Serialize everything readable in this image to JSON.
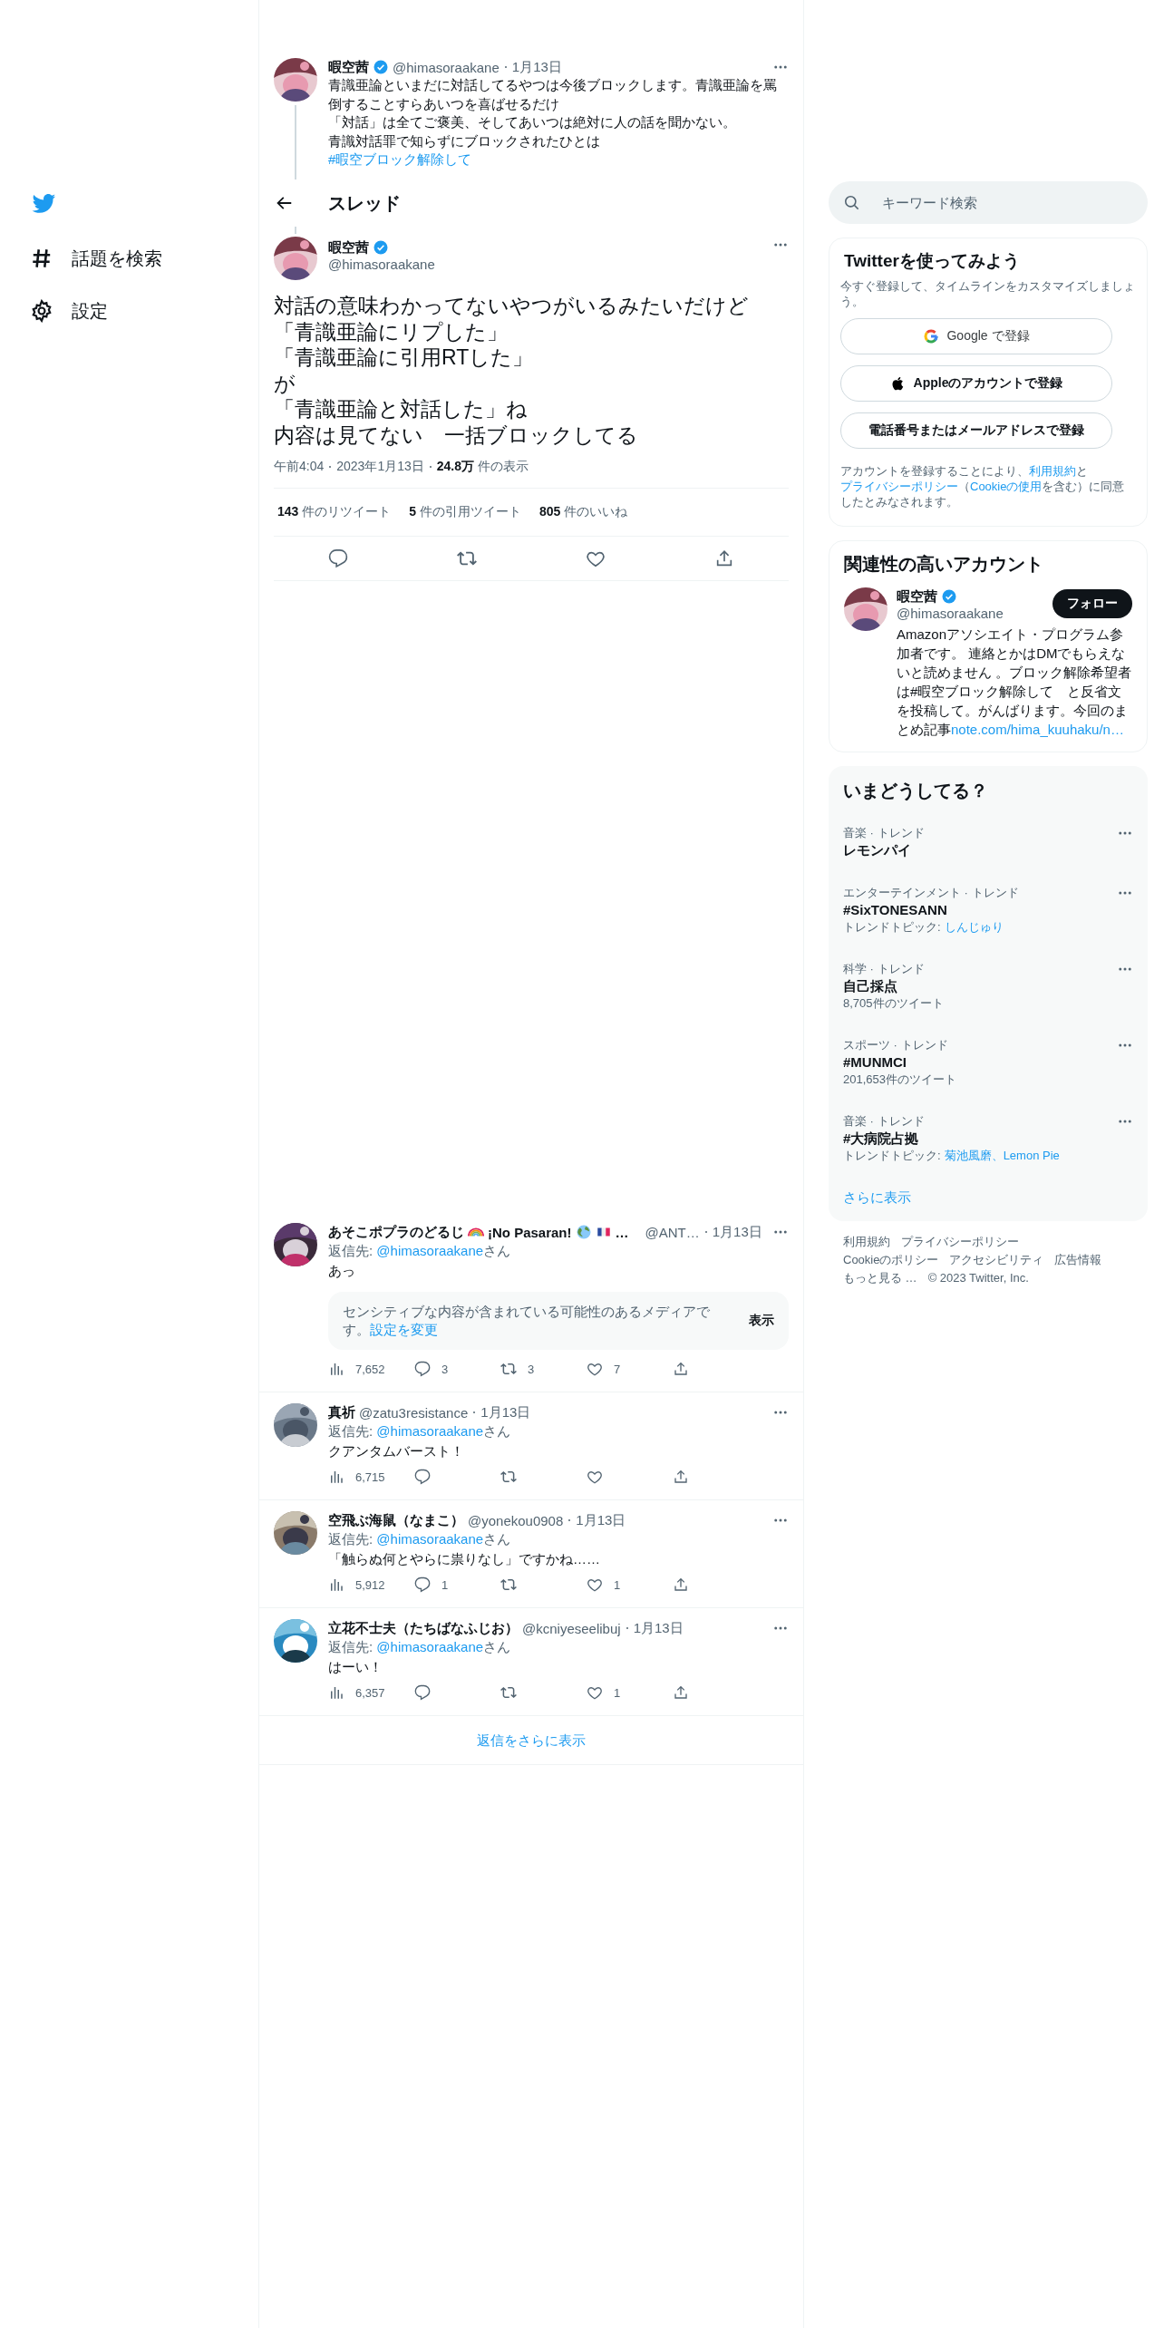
{
  "nav": {
    "items": [
      {
        "kind": "explore",
        "label": "話題を検索"
      },
      {
        "kind": "settings",
        "label": "設定"
      }
    ]
  },
  "parent_tweet": {
    "name": "暇空茜",
    "verified": true,
    "handle": "@himasoraakane",
    "date": "1月13日",
    "body": [
      {
        "kind": "text",
        "text": "青識亜論といまだに対話してるやつは今後ブロックします。青識亜論を罵倒することすらあいつを喜ばせるだけ"
      },
      {
        "kind": "text",
        "text": "「対話」は全てご褒美、そしてあいつは絶対に人の話を聞かない。"
      },
      {
        "kind": "text",
        "text": "青識対話罪で知らずにブロックされたひとは"
      },
      {
        "kind": "hashtag",
        "text": "#暇空ブロック解除して"
      }
    ]
  },
  "thread_header": {
    "title": "スレッド"
  },
  "main_tweet": {
    "name": "暇空茜",
    "verified": true,
    "handle": "@himasoraakane",
    "lines": [
      "対話の意味わかってないやつがいるみたいだけど",
      "「青識亜論にリプした」",
      "「青識亜論に引用RTした」",
      "が",
      "「青識亜論と対話した」ね",
      "内容は見てない　一括ブロックしてる"
    ],
    "time": "午前4:04",
    "date": "2023年1月13日",
    "views": "24.8万",
    "views_label": "件の表示",
    "stats": [
      {
        "count": "143",
        "label": "件のリツイート"
      },
      {
        "count": "5",
        "label": "件の引用ツイート"
      },
      {
        "count": "805",
        "label": "件のいいね"
      }
    ]
  },
  "replies": [
    {
      "name": "あそこポプラのどるじ",
      "name_suffix": "¡No Pasaran!",
      "name_cut": "…",
      "handle": "@ANT…",
      "date": "1月13日",
      "reply_to_label": "返信先:",
      "reply_to": "@himasoraakane",
      "reply_to_suffix": "さん",
      "text": "あっ",
      "media_notice": {
        "text": "センシティブな内容が含まれている可能性のあるメディアです。",
        "link": "設定を変更",
        "button": "表示"
      },
      "views": "7,652",
      "reply_count": "3",
      "retweet_count": "3",
      "like_count": "7"
    },
    {
      "name": "真祈",
      "handle": "@zatu3resistance",
      "date": "1月13日",
      "reply_to_label": "返信先:",
      "reply_to": "@himasoraakane",
      "reply_to_suffix": "さん",
      "text": "クアンタムバースト！",
      "views": "6,715"
    },
    {
      "name": "空飛ぶ海鼠（なまこ）",
      "handle": "@yonekou0908",
      "date": "1月13日",
      "reply_to_label": "返信先:",
      "reply_to": "@himasoraakane",
      "reply_to_suffix": "さん",
      "text": "「触らぬ何とやらに祟りなし」ですかね……",
      "views": "5,912",
      "reply_count": "1",
      "like_count": "1"
    },
    {
      "name": "立花不士夫（たちばなふじお）",
      "handle": "@kcniyeseelibuj",
      "date": "1月13日",
      "reply_to_label": "返信先:",
      "reply_to": "@himasoraakane",
      "reply_to_suffix": "さん",
      "text": "はーい！",
      "views": "6,357",
      "like_count": "1"
    }
  ],
  "show_more_replies": "返信をさらに表示",
  "search": {
    "placeholder": "キーワード検索"
  },
  "signup": {
    "title": "Twitterを使ってみよう",
    "description": "今すぐ登録して、タイムラインをカスタマイズしましょう。",
    "buttons": [
      {
        "kind": "google",
        "label": "Google で登録"
      },
      {
        "kind": "apple",
        "label": "Appleのアカウントで登録"
      },
      {
        "kind": "plain",
        "label": "電話番号またはメールアドレスで登録"
      }
    ],
    "terms": [
      {
        "kind": "text",
        "text": "アカウントを登録することにより、"
      },
      {
        "kind": "link",
        "text": "利用規約"
      },
      {
        "kind": "text",
        "text": "と"
      },
      {
        "kind": "link",
        "text": "プライバシーポリシー"
      },
      {
        "kind": "text",
        "text": "（"
      },
      {
        "kind": "link",
        "text": "Cookieの使用"
      },
      {
        "kind": "text",
        "text": "を含む）に同意したとみなされます。"
      }
    ]
  },
  "related": {
    "title": "関連性の高いアカウント",
    "accounts": [
      {
        "name": "暇空茜",
        "verified": true,
        "handle": "@himasoraakane",
        "follow_label": "フォロー",
        "bio": "Amazonアソシエイト・プログラム参加者です。 連絡とかはDMでもらえないと読めません 。ブロック解除希望者は#暇空ブロック解除して　と反省文を投稿して。がんばります。今回のまとめ記事",
        "bio_link": "note.com/hima_kuuhaku/n…"
      }
    ]
  },
  "trends": {
    "title": "いまどうしてる？",
    "topic_separator": "、",
    "items": [
      {
        "category": "音楽 · トレンド",
        "name": "レモンパイ"
      },
      {
        "category": "エンターテインメント · トレンド",
        "name": "#SixTONESANN",
        "topics_label": "トレンドトピック:",
        "topics": [
          "しんじゅり"
        ]
      },
      {
        "category": "科学 · トレンド",
        "name": "自己採点",
        "count": "8,705件のツイート"
      },
      {
        "category": "スポーツ · トレンド",
        "name": "#MUNMCI",
        "count": "201,653件のツイート"
      },
      {
        "category": "音楽 · トレンド",
        "name": "#大病院占拠",
        "topics_label": "トレンドトピック:",
        "topics": [
          "菊池風磨",
          "Lemon Pie"
        ]
      }
    ],
    "more": "さらに表示"
  },
  "footer": {
    "links": [
      "利用規約",
      "プライバシーポリシー",
      "Cookieのポリシー",
      "アクセシビリティ",
      "広告情報",
      "もっと見る …"
    ],
    "copyright": "© 2023 Twitter, Inc."
  }
}
